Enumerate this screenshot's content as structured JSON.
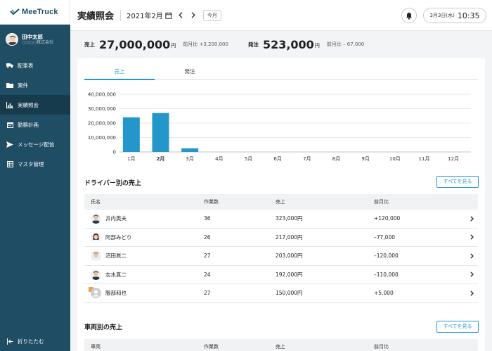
{
  "app": {
    "logo_text": "MeeTruck"
  },
  "user": {
    "name": "田中太郎",
    "company": "○○○○株式会社"
  },
  "sidebar": {
    "items": [
      {
        "label": "配車表",
        "icon": "truck-icon"
      },
      {
        "label": "案件",
        "icon": "folder-icon"
      },
      {
        "label": "実績照会",
        "icon": "bar-chart-icon",
        "active": true
      },
      {
        "label": "勤務計画",
        "icon": "calendar-icon"
      },
      {
        "label": "メッセージ配信",
        "icon": "send-icon"
      },
      {
        "label": "マスタ管理",
        "icon": "grid-icon"
      }
    ],
    "collapse_label": "折りたたむ"
  },
  "header": {
    "title": "実績照会",
    "month": "2021年2月",
    "today_label": "今月",
    "date": "3月3日(水)",
    "time": "10:35"
  },
  "summary": {
    "sales_label": "売上",
    "sales_value": "27,000,000",
    "sales_unit": "円",
    "sales_diff": "前月比 +3,200,000",
    "orders_label": "発注",
    "orders_value": "523,000",
    "orders_unit": "円",
    "orders_diff": "前月比 – 67,000"
  },
  "tabs": [
    "売上",
    "発注"
  ],
  "chart_data": {
    "type": "bar",
    "categories": [
      "1月",
      "2月",
      "3月",
      "4月",
      "5月",
      "6月",
      "7月",
      "8月",
      "9月",
      "10月",
      "11月",
      "12月"
    ],
    "values": [
      24000000,
      27000000,
      2500000,
      0,
      0,
      0,
      0,
      0,
      0,
      0,
      0,
      0
    ],
    "y_ticks": [
      "40,000,000",
      "30,000,000",
      "20,000,000",
      "10,000,000",
      "0"
    ],
    "ylim": [
      0,
      40000000
    ],
    "highlight_category": "2月",
    "bar_color": "#2596c9",
    "grid": true
  },
  "drivers": {
    "title": "ドライバー別の売上",
    "see_all": "すべてを見る",
    "columns": [
      "氏名",
      "作業数",
      "売上",
      "前月比"
    ],
    "rows": [
      {
        "name": "井内英夫",
        "work": "36",
        "sales": "323,000円",
        "diff": "+120,000"
      },
      {
        "name": "阿部みどり",
        "work": "26",
        "sales": "217,000円",
        "diff": "–77,000"
      },
      {
        "name": "沼田眞二",
        "work": "27",
        "sales": "203,000円",
        "diff": "–120,000"
      },
      {
        "name": "志水真二",
        "work": "24",
        "sales": "192,000円",
        "diff": "–110,000"
      },
      {
        "name": "服部和也",
        "work": "27",
        "sales": "150,000円",
        "diff": "+5,000"
      }
    ]
  },
  "vehicles": {
    "title": "車両別の売上",
    "see_all": "すべてを見る",
    "columns": [
      "車両",
      "作業数",
      "売上",
      "前月比"
    ]
  }
}
